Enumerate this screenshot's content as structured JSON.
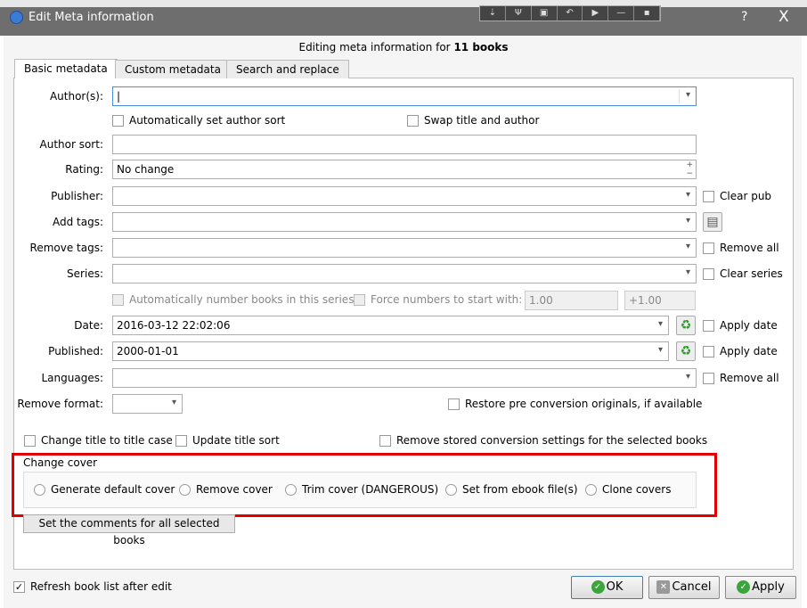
{
  "window": {
    "title": "Edit Meta information",
    "help": "?",
    "close": "X",
    "toolbox": [
      "⇣",
      "Ψ",
      "▣",
      "↶",
      "▶",
      "—",
      "▪"
    ]
  },
  "heading": {
    "prefix": "Editing meta information for ",
    "count": "11 books"
  },
  "tabs": [
    "Basic metadata",
    "Custom metadata",
    "Search and replace"
  ],
  "fields": {
    "authors": {
      "label": "Author(s):",
      "value": ""
    },
    "auto_author_sort": "Automatically set author sort",
    "swap_title_author": "Swap title and author",
    "author_sort": {
      "label": "Author sort:",
      "value": ""
    },
    "rating": {
      "label": "Rating:",
      "value": "No change"
    },
    "publisher": {
      "label": "Publisher:",
      "value": "",
      "extra": "Clear pub"
    },
    "add_tags": {
      "label": "Add tags:",
      "value": ""
    },
    "remove_tags": {
      "label": "Remove tags:",
      "value": "",
      "extra": "Remove all"
    },
    "series": {
      "label": "Series:",
      "value": "",
      "extra": "Clear series"
    },
    "auto_number": "Automatically number books in this series",
    "force_numbers": "Force numbers to start with:",
    "start_value": "1.00",
    "increment_value": "+1.00",
    "date": {
      "label": "Date:",
      "value": "2016-03-12 22:02:06",
      "extra": "Apply date"
    },
    "published": {
      "label": "Published:",
      "value": "2000-01-01",
      "extra": "Apply date"
    },
    "languages": {
      "label": "Languages:",
      "value": "",
      "extra": "Remove all"
    },
    "remove_format": {
      "label": "Remove format:",
      "value": ""
    },
    "restore_pre": "Restore pre conversion originals, if available",
    "change_title_case": "Change title to title case",
    "update_title_sort": "Update title sort",
    "remove_conversion": "Remove stored conversion settings for the selected books"
  },
  "cover": {
    "label": "Change cover",
    "options": [
      "Generate default cover",
      "Remove cover",
      "Trim cover (DANGEROUS)",
      "Set from ebook file(s)",
      "Clone covers"
    ]
  },
  "comments_button": "Set the comments for all selected books",
  "footer": {
    "refresh": "Refresh book list after edit",
    "ok": "OK",
    "cancel": "Cancel",
    "apply": "Apply"
  },
  "colors": {
    "highlight": "#e00000",
    "titlebar": "#6e6e6e"
  }
}
